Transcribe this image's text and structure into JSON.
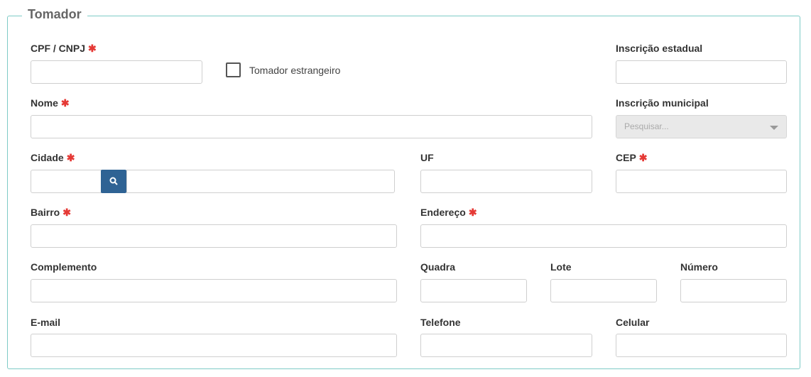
{
  "legend": "Tomador",
  "fields": {
    "cpf_cnpj": {
      "label": "CPF / CNPJ",
      "value": ""
    },
    "estrangeiro": {
      "label": "Tomador estrangeiro",
      "checked": false
    },
    "inscricao_estadual": {
      "label": "Inscrição estadual",
      "value": ""
    },
    "nome": {
      "label": "Nome",
      "value": ""
    },
    "inscricao_municipal": {
      "label": "Inscrição municipal",
      "placeholder": "Pesquisar..."
    },
    "cidade": {
      "label": "Cidade",
      "code": "",
      "name": ""
    },
    "uf": {
      "label": "UF",
      "value": ""
    },
    "cep": {
      "label": "CEP",
      "value": ""
    },
    "bairro": {
      "label": "Bairro",
      "value": ""
    },
    "endereco": {
      "label": "Endereço",
      "value": ""
    },
    "complemento": {
      "label": "Complemento",
      "value": ""
    },
    "quadra": {
      "label": "Quadra",
      "value": ""
    },
    "lote": {
      "label": "Lote",
      "value": ""
    },
    "numero": {
      "label": "Número",
      "value": ""
    },
    "email": {
      "label": "E-mail",
      "value": ""
    },
    "telefone": {
      "label": "Telefone",
      "value": ""
    },
    "celular": {
      "label": "Celular",
      "value": ""
    }
  },
  "required_marker": "✱",
  "icons": {
    "search": "search-icon",
    "dropdown": "caret-down-icon"
  },
  "colors": {
    "border": "#7ecbc6",
    "required": "#e53935",
    "button": "#2f6394"
  }
}
